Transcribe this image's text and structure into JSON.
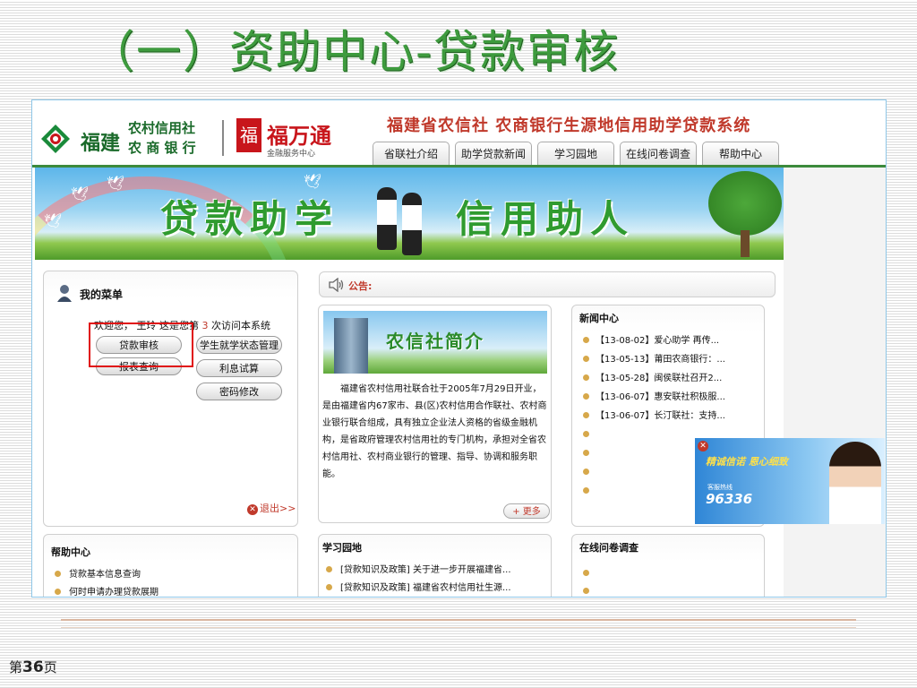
{
  "slide": {
    "title": "（一）资助中心-贷款审核",
    "page_prefix": "第",
    "page_number": "36",
    "page_suffix": "页"
  },
  "site": {
    "logo_region": "福建",
    "logo_org_line1": "农村信用社",
    "logo_org_line2": "农 商 银 行",
    "logo_brand": "福万通",
    "logo_brand_sub": "金融服务中心",
    "system_title": "福建省农信社 农商银行生源地信用助学贷款系统",
    "nav": [
      "省联社介绍",
      "助学贷款新闻",
      "学习园地",
      "在线问卷调查",
      "帮助中心"
    ],
    "banner_left": "贷款助学",
    "banner_right": "信用助人"
  },
  "menu": {
    "title": "我的菜单",
    "welcome_prefix": "欢迎您，",
    "user": "王玲",
    "welcome_mid": "这是您第",
    "visit_count": "3",
    "welcome_suffix": "次访问本系统",
    "buttons": {
      "loan_review": "贷款审核",
      "report_query": "报表查询",
      "student_status": "学生就学状态管理",
      "interest_calc": "利息试算",
      "password_change": "密码修改"
    },
    "logout": "退出>>"
  },
  "notice": {
    "label": "公告:"
  },
  "intro": {
    "image_title": "农信社简介",
    "text": "福建省农村信用社联合社于2005年7月29日开业，是由福建省内67家市、县(区)农村信用合作联社、农村商业银行联合组成，具有独立企业法人资格的省级金融机构，是省政府管理农村信用社的专门机构，承担对全省农村信用社、农村商业银行的管理、指导、协调和服务职能。",
    "more": "更多"
  },
  "news": {
    "title": "新闻中心",
    "items": [
      "【13-08-02】爱心助学 再传...",
      "【13-05-13】莆田农商银行：...",
      "【13-05-28】闽侯联社召开2...",
      "【13-06-07】惠安联社积极服...",
      "【13-06-07】长汀联社：支持...",
      "",
      "",
      "",
      ""
    ]
  },
  "help": {
    "title": "帮助中心",
    "items": [
      "贷款基本信息查询",
      "何时申请办理贷款展期"
    ]
  },
  "study": {
    "title": "学习园地",
    "items": [
      "[贷款知识及政策] 关于进一步开展福建省...",
      "[贷款知识及政策] 福建省农村信用社生源..."
    ]
  },
  "survey": {
    "title": "在线问卷调查",
    "items": [
      "",
      ""
    ]
  },
  "ad": {
    "slogan": "精诚信诺 恩心细致",
    "hotline_label": "客服热线",
    "phone": "96336"
  },
  "colors": {
    "title_green": "#3e9b3e",
    "brand_green": "#1a6a2a",
    "system_red": "#c0392b",
    "highlight_red": "#e01010",
    "frame_blue": "#8fc7e8"
  }
}
